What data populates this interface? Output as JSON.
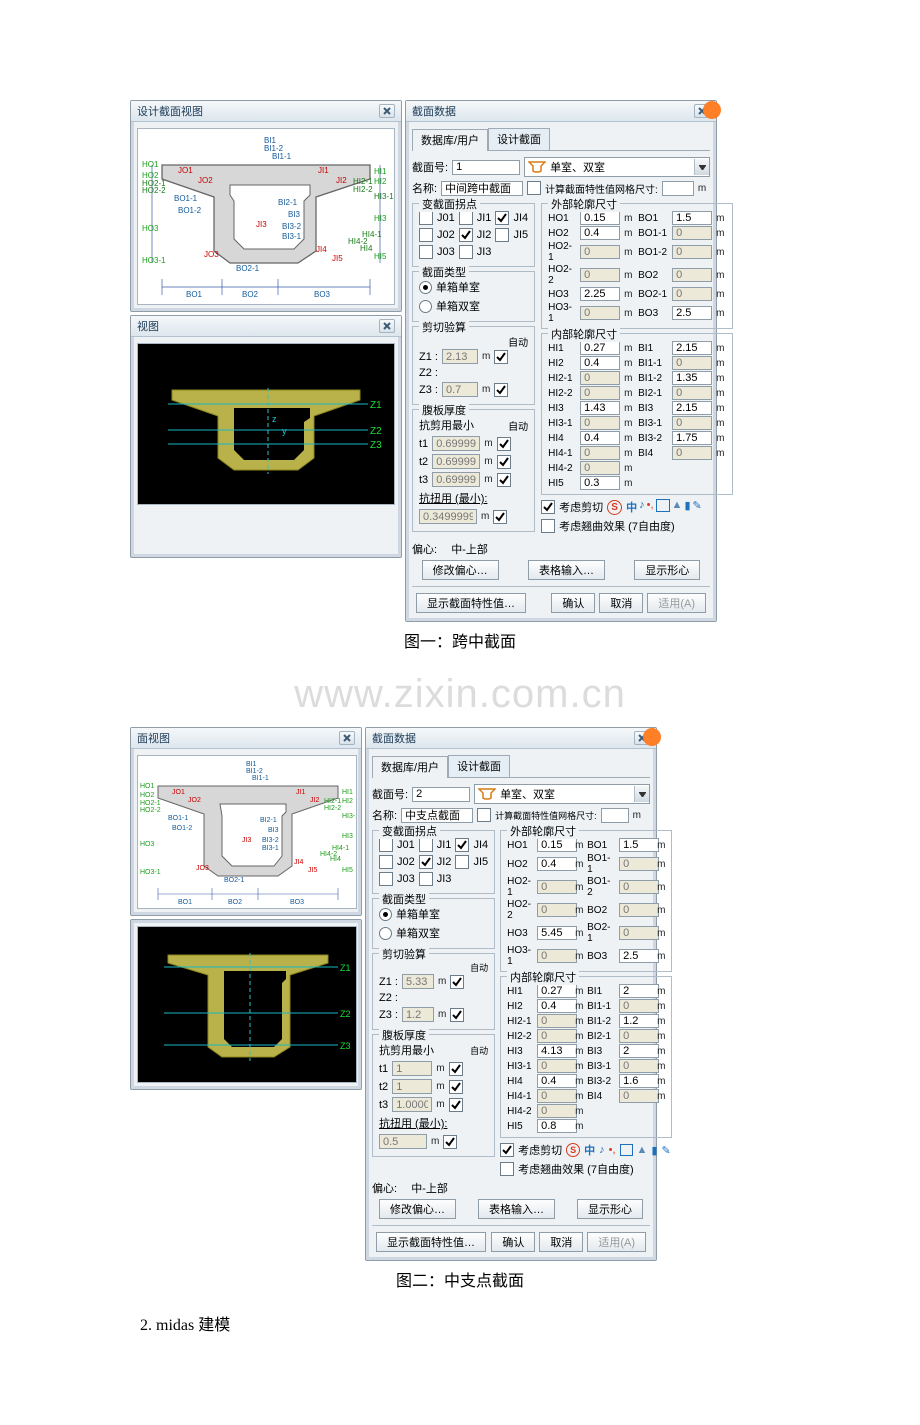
{
  "caption1": "图一：跨中截面",
  "caption2": "图二：中支点截面",
  "watermark": "www.zixin.com.cn",
  "heading": "2. midas 建模",
  "panes": {
    "left_title": "设计截面视图",
    "right_title": "截面数据",
    "view_title": "视图"
  },
  "tabs": {
    "t1": "数据库/用户",
    "t2": "设计截面"
  },
  "form": {
    "sec_no_label": "截面号:",
    "name_label": "名称:",
    "dd_text": "单室、双室",
    "mesh_chk": "计算截面特性值网格尺寸:",
    "mesh_unit": "m",
    "g_inflect": "变截面拐点",
    "g_outer": "外部轮廓尺寸",
    "g_type": "截面类型",
    "type_r1": "单箱单室",
    "type_r2": "单箱双室",
    "g_shear": "剪切验算",
    "g_inner": "内部轮廓尺寸",
    "g_web": "腹板厚度",
    "web_text1": "抗剪用最小",
    "web_text2": "抗扭用 (最小):",
    "auto": "自动",
    "offset_label": "偏心:",
    "offset_val": "中-上部",
    "btn_offset": "修改偏心…",
    "btn_table": "表格输入…",
    "btn_centroid": "显示形心",
    "btn_prop": "显示截面特性值…",
    "btn_ok": "确认",
    "btn_cancel": "取消",
    "btn_apply": "适用(A)",
    "consider_shear": "考虑剪切",
    "consider_warp": "考虑翘曲效果 (7自由度)"
  },
  "section1": {
    "sec_no": "1",
    "name": "中间跨中截面",
    "inflect": {
      "J01": false,
      "JI1": false,
      "JI4": true,
      "J02": false,
      "JI2": true,
      "JI5": false,
      "J03": false,
      "JI3": false
    },
    "outer": {
      "HO1": "0.15",
      "BO1": "1.5",
      "HO2": "0.4",
      "BO1-1": "0",
      "HO2-1": "0",
      "BO1-2": "0",
      "HO2-2": "0",
      "BO2": "0",
      "HO3": "2.25",
      "BO2-1": "0",
      "HO3-1": "0",
      "BO3": "2.5"
    },
    "inner": {
      "HI1": "0.27",
      "BI1": "2.15",
      "HI2": "0.4",
      "BI1-1": "0",
      "HI2-1": "0",
      "BI1-2": "1.35",
      "HI2-2": "0",
      "BI2-1": "0",
      "HI3": "1.43",
      "BI3": "2.15",
      "HI3-1": "0",
      "BI3-1b": "0",
      "HI4": "0.4",
      "BI3-2": "1.75",
      "HI4-1": "0",
      "BI4": "0",
      "HI4-2": "0",
      "HI5": "0.3"
    },
    "shear": {
      "Z1": "2.13",
      "Z3": "0.7",
      "Z1auto": true,
      "Z3auto": true
    },
    "web": {
      "t1": "0.69999",
      "t2": "0.69999",
      "t3": "0.69999",
      "tt": "0.34999997",
      "a1": true,
      "a2": true,
      "a3": true,
      "a4": true
    }
  },
  "section2": {
    "sec_no": "2",
    "name": "中支点截面",
    "inflect": {
      "J01": false,
      "JI1": false,
      "JI4": true,
      "J02": false,
      "JI2": true,
      "JI5": false,
      "J03": false,
      "JI3": false
    },
    "outer": {
      "HO1": "0.15",
      "BO1": "1.5",
      "HO2": "0.4",
      "BO1-1": "0",
      "HO2-1": "0",
      "BO1-2": "0",
      "HO2-2": "0",
      "BO2": "0",
      "HO3": "5.45",
      "BO2-1": "0",
      "HO3-1": "0",
      "BO3": "2.5"
    },
    "inner": {
      "HI1": "0.27",
      "BI1": "2",
      "HI2": "0.4",
      "BI1-1": "0",
      "HI2-1": "0",
      "BI1-2": "1.2",
      "HI2-2": "0",
      "BI2-1": "0",
      "HI3": "4.13",
      "BI3": "2",
      "HI3-1": "0",
      "BI3-1b": "0",
      "HI4": "0.4",
      "BI3-2": "1.6",
      "HI4-1": "0",
      "BI4": "0",
      "HI4-2": "0",
      "HI5": "0.8"
    },
    "shear": {
      "Z1": "5.33",
      "Z3": "1.2",
      "Z1auto": true,
      "Z3auto": true
    },
    "web": {
      "t1": "1",
      "t2": "1",
      "t3": "1.00000",
      "tt": "0.5",
      "a1": true,
      "a2": true,
      "a3": true,
      "a4": true
    }
  },
  "diag_labels": {
    "top": [
      "BI1",
      "BI1-2",
      "BI1-1"
    ],
    "left": [
      "HO1",
      "HO2",
      "HO2-1",
      "HO2-2",
      "HO3",
      "HO3-1",
      "JO1",
      "JO2"
    ],
    "right": [
      "HI1",
      "HI2",
      "HI2-1",
      "HI2-2",
      "HI3",
      "HI4",
      "HI5",
      "HI3-1",
      "HI4-2",
      "HI4-1",
      "JI1",
      "JI2",
      "JO3",
      "JI4",
      "JI5",
      "JI3",
      "JI3"
    ],
    "mid": [
      "BO1-1",
      "BO1-2",
      "BI2-1",
      "BI3",
      "BI3-2",
      "BI3-1",
      "BO2-1"
    ],
    "bot": [
      "BO1",
      "BO2",
      "BO3"
    ],
    "z": [
      "Z1",
      "Z2",
      "Z3"
    ]
  }
}
